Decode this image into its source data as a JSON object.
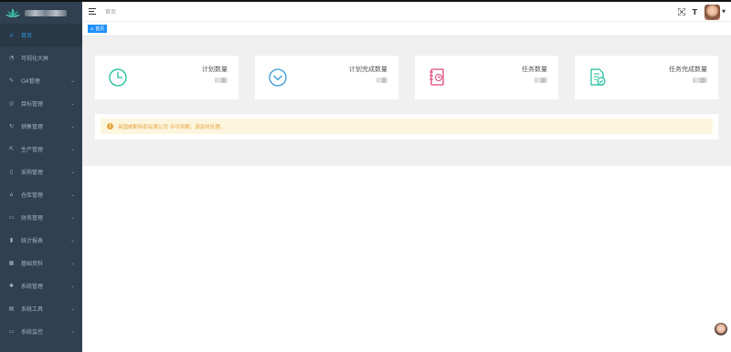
{
  "app": {
    "brand_label": ""
  },
  "sidebar": {
    "items": [
      {
        "label": "首页",
        "icon": "home-icon",
        "has_chevron": false,
        "active": true
      },
      {
        "label": "可视化大屏",
        "icon": "dashboard-icon",
        "has_chevron": false,
        "active": false
      },
      {
        "label": "OA管理",
        "icon": "edit-icon",
        "has_chevron": true,
        "active": false
      },
      {
        "label": "目标管理",
        "icon": "target-icon",
        "has_chevron": true,
        "active": false
      },
      {
        "label": "销售管理",
        "icon": "refresh-icon",
        "has_chevron": true,
        "active": false
      },
      {
        "label": "生产管理",
        "icon": "external-icon",
        "has_chevron": true,
        "active": false
      },
      {
        "label": "采购管理",
        "icon": "book-icon",
        "has_chevron": true,
        "active": false
      },
      {
        "label": "仓库管理",
        "icon": "warehouse-icon",
        "has_chevron": true,
        "active": false
      },
      {
        "label": "财务管理",
        "icon": "finance-icon",
        "has_chevron": true,
        "active": false
      },
      {
        "label": "统计报表",
        "icon": "bar-chart-icon",
        "has_chevron": true,
        "active": false
      },
      {
        "label": "基础资料",
        "icon": "grid-icon",
        "has_chevron": true,
        "active": false
      },
      {
        "label": "系统管理",
        "icon": "gear-icon",
        "has_chevron": true,
        "active": false
      },
      {
        "label": "系统工具",
        "icon": "tools-icon",
        "has_chevron": true,
        "active": false
      },
      {
        "label": "系统监控",
        "icon": "monitor-icon",
        "has_chevron": true,
        "active": false
      }
    ]
  },
  "header": {
    "breadcrumb": "首页",
    "right_text_icon": "T"
  },
  "tags": {
    "active": "首页"
  },
  "cards": [
    {
      "title": "计划数量",
      "icon": "clock-icon",
      "color": "#1abc9c"
    },
    {
      "title": "计划完成数量",
      "icon": "chevron-circle-icon",
      "color": "#3498db"
    },
    {
      "title": "任务数量",
      "icon": "task-doc-icon",
      "color": "#e0457b"
    },
    {
      "title": "任务完成数量",
      "icon": "checked-doc-icon",
      "color": "#1abc9c"
    }
  ],
  "notice": {
    "text": "英国威斯特彭有限公司 许可到期，请及时处理。",
    "icon": "!",
    "color": "#e6a23c"
  },
  "colors": {
    "sidebar_bg": "#2f4050",
    "accent": "#1e90ff",
    "content_bg": "#f0f0f0"
  }
}
